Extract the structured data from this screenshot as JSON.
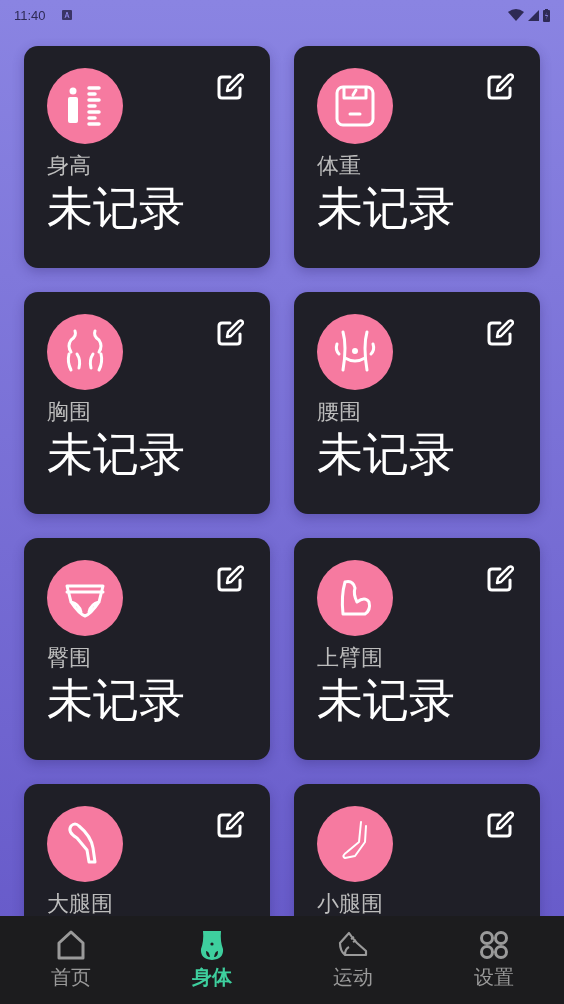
{
  "status_bar": {
    "time": "11:40"
  },
  "cards": [
    {
      "label": "身高",
      "value": "未记录"
    },
    {
      "label": "体重",
      "value": "未记录"
    },
    {
      "label": "胸围",
      "value": "未记录"
    },
    {
      "label": "腰围",
      "value": "未记录"
    },
    {
      "label": "臀围",
      "value": "未记录"
    },
    {
      "label": "上臂围",
      "value": "未记录"
    },
    {
      "label": "大腿围"
    },
    {
      "label": "小腿围"
    }
  ],
  "nav": [
    {
      "label": "首页",
      "selected": false
    },
    {
      "label": "身体",
      "selected": true
    },
    {
      "label": "运动",
      "selected": false
    },
    {
      "label": "设置",
      "selected": false
    }
  ]
}
